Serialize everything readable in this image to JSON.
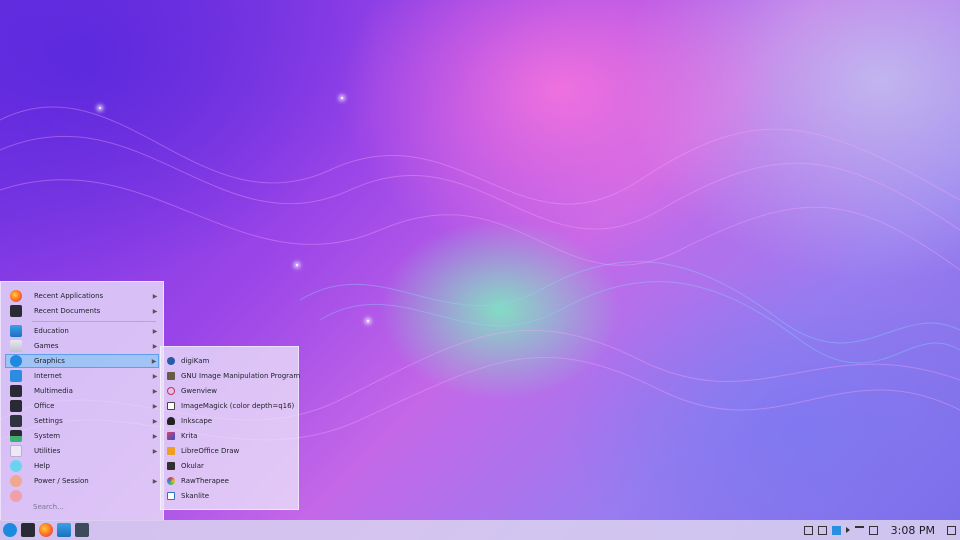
{
  "main_menu": {
    "items": [
      {
        "label": "Recent Applications",
        "icon": "firefox-icon",
        "submenu": true
      },
      {
        "label": "Recent Documents",
        "icon": "terminal-icon",
        "submenu": true
      },
      {
        "label": "Education",
        "icon": "folder-icon",
        "submenu": true
      },
      {
        "label": "Games",
        "icon": "folder-icon",
        "submenu": true
      },
      {
        "label": "Graphics",
        "icon": "kde-icon",
        "submenu": true,
        "active": true
      },
      {
        "label": "Internet",
        "icon": "network-icon",
        "submenu": true
      },
      {
        "label": "Multimedia",
        "icon": "monitor-icon",
        "submenu": true
      },
      {
        "label": "Office",
        "icon": "document-icon",
        "submenu": true
      },
      {
        "label": "Settings",
        "icon": "terminal-icon",
        "submenu": true
      },
      {
        "label": "System",
        "icon": "system-monitor-icon",
        "submenu": true
      },
      {
        "label": "Utilities",
        "icon": "settings-icon",
        "submenu": true
      },
      {
        "label": "Help",
        "icon": "help-icon",
        "submenu": false
      },
      {
        "label": "Power / Session",
        "icon": "power-icon",
        "submenu": true
      }
    ],
    "search_placeholder": "Search..."
  },
  "graphics_submenu": {
    "items": [
      {
        "label": "digiKam",
        "icon": "digikam-icon",
        "color": "#2a5aa8"
      },
      {
        "label": "GNU Image Manipulation Program",
        "icon": "gimp-icon",
        "color": "#6b5a45"
      },
      {
        "label": "Gwenview",
        "icon": "gwenview-icon",
        "color": "#d03050"
      },
      {
        "label": "ImageMagick (color depth=q16)",
        "icon": "imagemagick-icon",
        "color": "#444444"
      },
      {
        "label": "Inkscape",
        "icon": "inkscape-icon",
        "color": "#222222"
      },
      {
        "label": "Krita",
        "icon": "krita-icon",
        "color": "#3050d0"
      },
      {
        "label": "LibreOffice Draw",
        "icon": "libreoffice-draw-icon",
        "color": "#f0a020"
      },
      {
        "label": "Okular",
        "icon": "okular-icon",
        "color": "#303030"
      },
      {
        "label": "RawTherapee",
        "icon": "rawtherapee-icon",
        "color": "#e0a030"
      },
      {
        "label": "Skanlite",
        "icon": "skanlite-icon",
        "color": "#3070c0"
      }
    ]
  },
  "taskbar": {
    "launchers": [
      "kde-menu-icon",
      "terminal-icon",
      "firefox-icon",
      "file-manager-icon",
      "screenshot-icon"
    ],
    "tray": [
      "clipboard-icon",
      "image-icon",
      "network-icon",
      "volume-icon",
      "notifications-icon",
      "display-icon"
    ],
    "clock": "3:08 PM"
  },
  "colors": {
    "active_highlight": "#5da0e8",
    "menu_bg": "#ece4fa",
    "taskbar_bg": "#d7cdf0"
  }
}
